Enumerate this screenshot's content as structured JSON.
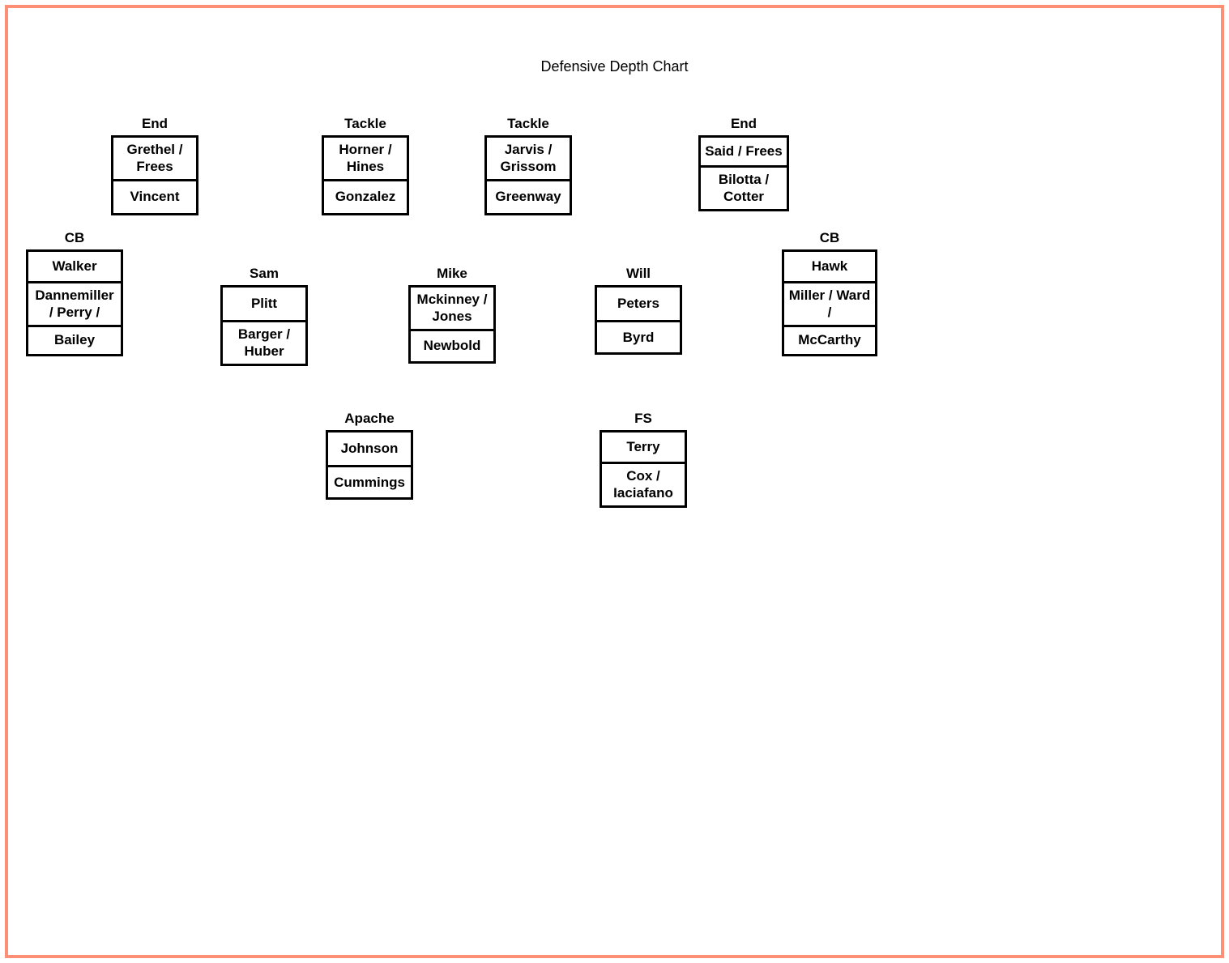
{
  "title": "Defensive Depth Chart",
  "chart_data": {
    "type": "table",
    "title": "Defensive Depth Chart",
    "rows": [
      {
        "position": "End",
        "slots": [
          "Grethel / Frees",
          "Vincent"
        ]
      },
      {
        "position": "Tackle",
        "slots": [
          "Horner / Hines",
          "Gonzalez"
        ]
      },
      {
        "position": "Tackle",
        "slots": [
          "Jarvis / Grissom",
          "Greenway"
        ]
      },
      {
        "position": "End",
        "slots": [
          "Said / Frees",
          "Bilotta / Cotter"
        ]
      },
      {
        "position": "CB",
        "slots": [
          "Walker",
          "Dannemiller / Perry /",
          "Bailey"
        ]
      },
      {
        "position": "Sam",
        "slots": [
          "Plitt",
          "Barger / Huber"
        ]
      },
      {
        "position": "Mike",
        "slots": [
          "Mckinney / Jones",
          "Newbold"
        ]
      },
      {
        "position": "Will",
        "slots": [
          "Peters",
          "Byrd"
        ]
      },
      {
        "position": "CB",
        "slots": [
          "Hawk",
          "Miller / Ward /",
          "McCarthy"
        ]
      },
      {
        "position": "Apache",
        "slots": [
          "Johnson",
          "Cummings"
        ]
      },
      {
        "position": "FS",
        "slots": [
          "Terry",
          "Cox / Iaciafano"
        ]
      }
    ]
  },
  "dl": {
    "le": {
      "label": "End",
      "s1": "Grethel / Frees",
      "s2": "Vincent"
    },
    "lt": {
      "label": "Tackle",
      "s1": "Horner / Hines",
      "s2": "Gonzalez"
    },
    "rt": {
      "label": "Tackle",
      "s1": "Jarvis / Grissom",
      "s2": "Greenway"
    },
    "re": {
      "label": "End",
      "s1": "Said / Frees",
      "s2": "Bilotta / Cotter"
    }
  },
  "lb": {
    "lcb": {
      "label": "CB",
      "s1": "Walker",
      "s2": "Dannemiller / Perry /",
      "s3": "Bailey"
    },
    "sam": {
      "label": "Sam",
      "s1": "Plitt",
      "s2": "Barger / Huber"
    },
    "mike": {
      "label": "Mike",
      "s1": "Mckinney / Jones",
      "s2": "Newbold"
    },
    "will": {
      "label": "Will",
      "s1": "Peters",
      "s2": "Byrd"
    },
    "rcb": {
      "label": "CB",
      "s1": "Hawk",
      "s2": "Miller / Ward /",
      "s3": "McCarthy"
    }
  },
  "db": {
    "apache": {
      "label": "Apache",
      "s1": "Johnson",
      "s2": "Cummings"
    },
    "fs": {
      "label": "FS",
      "s1": "Terry",
      "s2": "Cox / Iaciafano"
    }
  }
}
